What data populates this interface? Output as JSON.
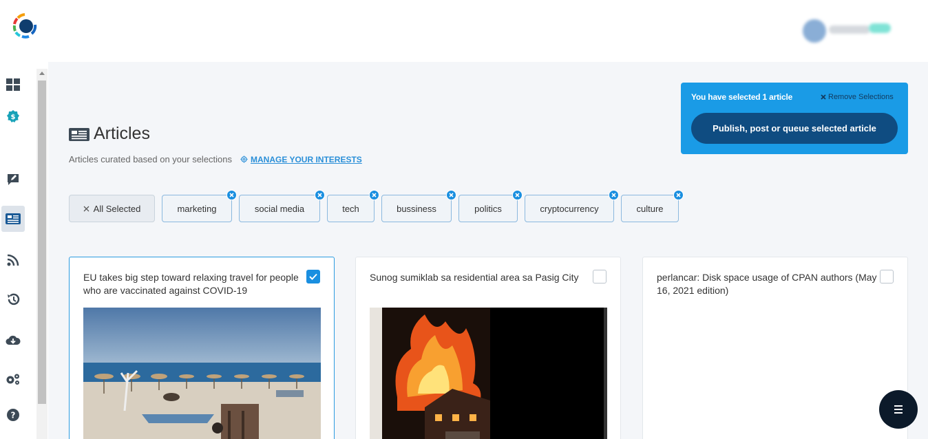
{
  "page": {
    "title": "Articles",
    "subtitle": "Articles curated based on your selections",
    "manage_link": "MANAGE YOUR INTERESTS"
  },
  "selection_panel": {
    "text": "You have selected 1 article",
    "remove_label": "Remove Selections",
    "publish_label": "Publish, post or queue selected article"
  },
  "tags": {
    "all_label": "All Selected",
    "items": [
      "marketing",
      "social media",
      "tech",
      "bussiness",
      "politics",
      "cryptocurrency",
      "culture"
    ]
  },
  "articles": [
    {
      "title": "EU takes big step toward relaxing travel for people who are vaccinated against COVID-19",
      "selected": true
    },
    {
      "title": "Sunog sumiklab sa residential area sa Pasig City",
      "selected": false
    },
    {
      "title": "perlancar: Disk space usage of CPAN authors (May 16, 2021 edition)",
      "selected": false
    }
  ],
  "colors": {
    "accent": "#1a9be6",
    "publish_button": "#0f4c81",
    "fab": "#0c1a2a"
  },
  "icons": {
    "nav": [
      "dashboard-icon",
      "dollar-badge-icon",
      "edit-comment-icon",
      "articles-icon",
      "rss-icon",
      "history-icon",
      "cloud-download-icon",
      "settings-icon",
      "help-icon"
    ]
  }
}
